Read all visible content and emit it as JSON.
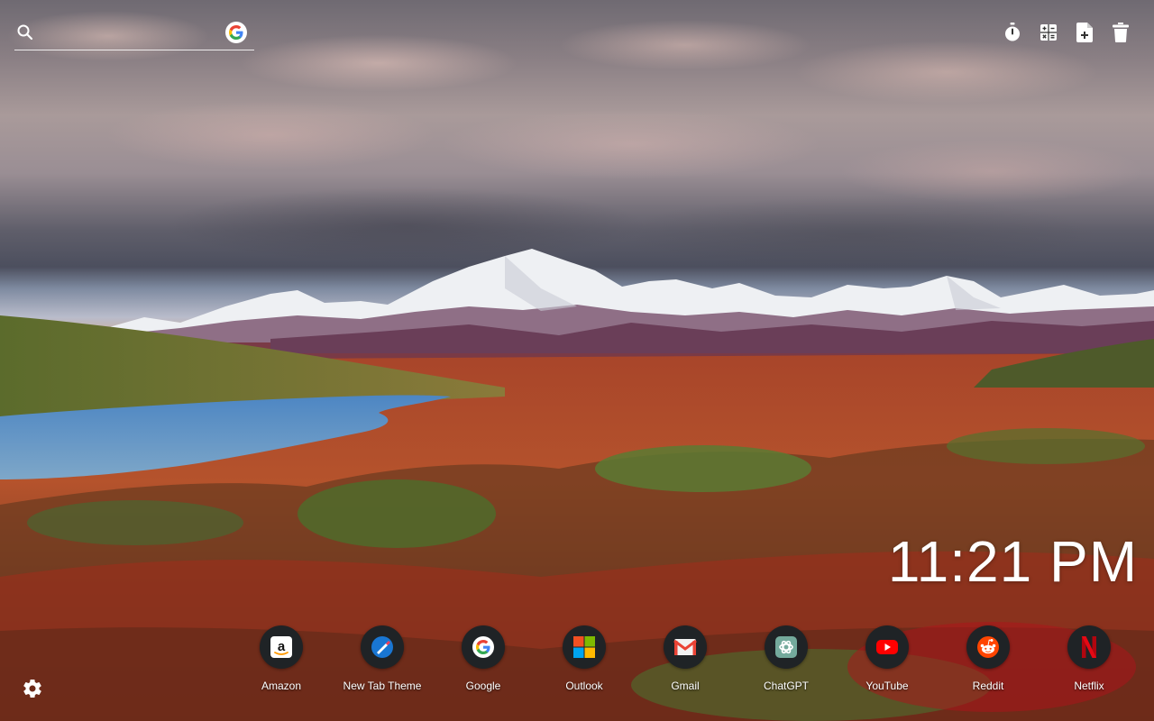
{
  "search": {
    "placeholder": "",
    "icon": "search-icon",
    "engine_icon": "google-icon"
  },
  "tools": [
    {
      "name": "timer",
      "icon": "stopwatch-icon"
    },
    {
      "name": "calculator",
      "icon": "calculator-icon"
    },
    {
      "name": "add-file",
      "icon": "file-add-icon"
    },
    {
      "name": "delete",
      "icon": "trash-icon"
    }
  ],
  "clock": {
    "time": "11:21 PM"
  },
  "shortcuts": [
    {
      "label": "Amazon",
      "icon": "amazon-icon"
    },
    {
      "label": "New Tab Theme",
      "icon": "new-tab-theme-icon"
    },
    {
      "label": "Google",
      "icon": "google-icon"
    },
    {
      "label": "Outlook",
      "icon": "outlook-icon"
    },
    {
      "label": "Gmail",
      "icon": "gmail-icon"
    },
    {
      "label": "ChatGPT",
      "icon": "chatgpt-icon"
    },
    {
      "label": "YouTube",
      "icon": "youtube-icon"
    },
    {
      "label": "Reddit",
      "icon": "reddit-icon"
    },
    {
      "label": "Netflix",
      "icon": "netflix-icon"
    }
  ],
  "settings": {
    "icon": "gear-icon"
  },
  "colors": {
    "icon_circle": "#1f2326",
    "google_blue": "#4285F4",
    "google_red": "#EA4335",
    "google_yellow": "#FBBC05",
    "google_green": "#34A853",
    "youtube_red": "#FF0000",
    "reddit_orange": "#FF4500",
    "netflix_red": "#E50914"
  }
}
